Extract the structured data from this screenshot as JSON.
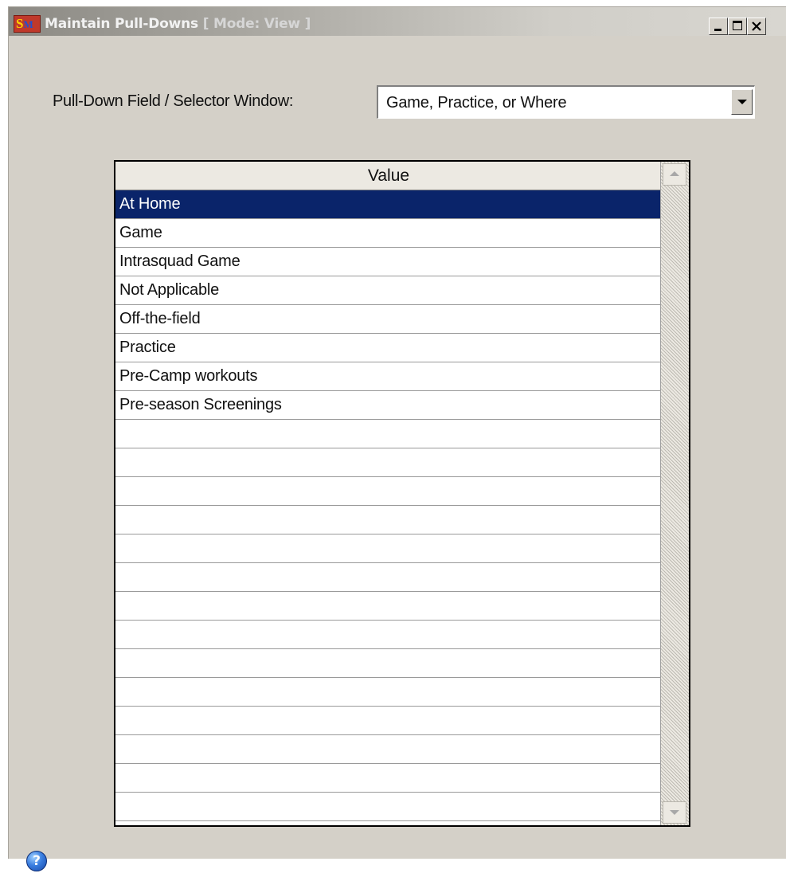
{
  "window": {
    "title": "Maintain Pull-Downs",
    "mode": "[ Mode: View ]",
    "icon_letters": {
      "s": "S",
      "m": "M"
    }
  },
  "titlebar_controls": [
    "minimize-icon",
    "maximize-icon",
    "close-icon"
  ],
  "selector": {
    "label": "Pull-Down Field / Selector Window:",
    "value": "Game, Practice, or Where"
  },
  "grid": {
    "column_header": "Value",
    "selected_index": 0,
    "rows": [
      "At Home",
      "Game",
      "Intrasquad Game",
      "Not Applicable",
      "Off-the-field",
      "Practice",
      "Pre-Camp workouts",
      "Pre-season Screenings",
      "",
      "",
      "",
      "",
      "",
      "",
      "",
      "",
      "",
      "",
      "",
      "",
      "",
      ""
    ]
  },
  "help": {
    "icon": "help-icon",
    "glyph": "?"
  },
  "colors": {
    "selection": "#0a246a",
    "window_bg": "#d4d0c8"
  }
}
